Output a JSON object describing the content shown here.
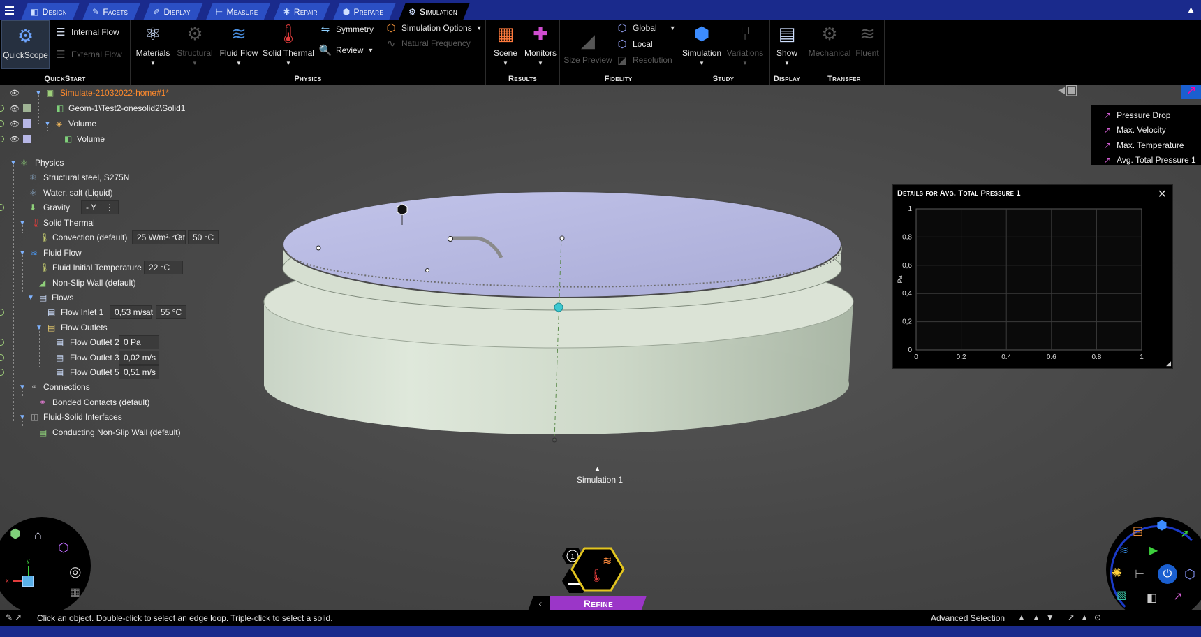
{
  "tabs": [
    {
      "label": "Design",
      "icon": "design-icon",
      "active": false
    },
    {
      "label": "Facets",
      "icon": "facets-icon",
      "active": false
    },
    {
      "label": "Display",
      "icon": "display-icon",
      "active": false
    },
    {
      "label": "Measure",
      "icon": "measure-icon",
      "active": false
    },
    {
      "label": "Repair",
      "icon": "repair-icon",
      "active": false
    },
    {
      "label": "Prepare",
      "icon": "prepare-icon",
      "active": false
    },
    {
      "label": "Simulation",
      "icon": "simulation-icon",
      "active": true
    }
  ],
  "ribbon": {
    "quickstart": {
      "label": "QuickStart",
      "quickscope": "QuickScope",
      "internal_flow": "Internal Flow",
      "external_flow": "External Flow"
    },
    "physics": {
      "label": "Physics",
      "materials": "Materials",
      "structural": "Structural",
      "fluid_flow": "Fluid Flow",
      "solid_thermal": "Solid Thermal",
      "symmetry": "Symmetry",
      "review": "Review",
      "simulation_options": "Simulation Options",
      "natural_frequency": "Natural Frequency"
    },
    "results": {
      "label": "Results",
      "scene": "Scene",
      "monitors": "Monitors"
    },
    "fidelity": {
      "label": "Fidelity",
      "size_preview": "Size Preview",
      "global": "Global",
      "local": "Local",
      "resolution": "Resolution"
    },
    "study": {
      "label": "Study",
      "simulation": "Simulation",
      "variations": "Variations"
    },
    "display": {
      "label": "Display",
      "show": "Show"
    },
    "transfer": {
      "label": "Transfer",
      "mechanical": "Mechanical",
      "fluent": "Fluent"
    }
  },
  "tree": {
    "root": "Simulate-21032022-home#1*",
    "geom": "Geom-1\\Test2-onesolid2\\Solid1",
    "volume_group": "Volume",
    "volume": "Volume",
    "physics": "Physics",
    "structural_steel": "Structural steel, S275N",
    "water": "Water, salt (Liquid)",
    "gravity": "Gravity",
    "gravity_val": "- Y",
    "solid_thermal": "Solid Thermal",
    "convection": "Convection (default)",
    "convection_coef": "25 W/m²·°C",
    "convection_temp": "50 °C",
    "at": "at",
    "fluid_flow": "Fluid Flow",
    "fluid_init_temp": "Fluid Initial Temperature",
    "fluid_init_temp_val": "22 °C",
    "non_slip": "Non-Slip Wall (default)",
    "flows": "Flows",
    "flow_inlet": "Flow Inlet 1",
    "flow_inlet_vel": "0,53 m/s",
    "flow_inlet_temp": "55 °C",
    "flow_outlets": "Flow Outlets",
    "outlet2": "Flow Outlet 2",
    "outlet2_val": "0 Pa",
    "outlet3": "Flow Outlet 3",
    "outlet3_val": "0,02 m/s",
    "outlet5": "Flow Outlet 5",
    "outlet5_val": "0,51 m/s",
    "connections": "Connections",
    "bonded": "Bonded Contacts (default)",
    "fsi": "Fluid-Solid Interfaces",
    "conducting": "Conducting Non-Slip Wall (default)"
  },
  "monitors_legend": [
    "Pressure Drop",
    "Max. Velocity",
    "Max. Temperature",
    "Avg. Total Pressure 1"
  ],
  "chart_panel": {
    "title": "Details for Avg. Total Pressure 1",
    "close": "✕"
  },
  "chart_data": {
    "type": "line",
    "title": "Details for Avg. Total Pressure 1",
    "xlabel": "",
    "ylabel": "Pa",
    "xlim": [
      0,
      1
    ],
    "ylim": [
      0,
      1
    ],
    "x_ticks": [
      "0",
      "0.2",
      "0.4",
      "0.6",
      "0.8",
      "1"
    ],
    "y_ticks": [
      "0",
      "0,2",
      "0,4",
      "0,6",
      "0,8",
      "1"
    ],
    "grid": true,
    "series": []
  },
  "hex_widget": {
    "label": "Simulation 1",
    "badge": "1"
  },
  "refine": {
    "label": "Refine",
    "back": "‹"
  },
  "status": {
    "message": "Click an object. Double-click to select an edge loop. Triple-click to select a solid.",
    "advanced_selection": "Advanced Selection"
  },
  "colors": {
    "tab_bar": "#1a2a8c",
    "tab": "#2b4fc4",
    "refine": "#9b36c8",
    "accent_cyan": "#3cc8d0",
    "hex_border": "#e3c51f"
  }
}
